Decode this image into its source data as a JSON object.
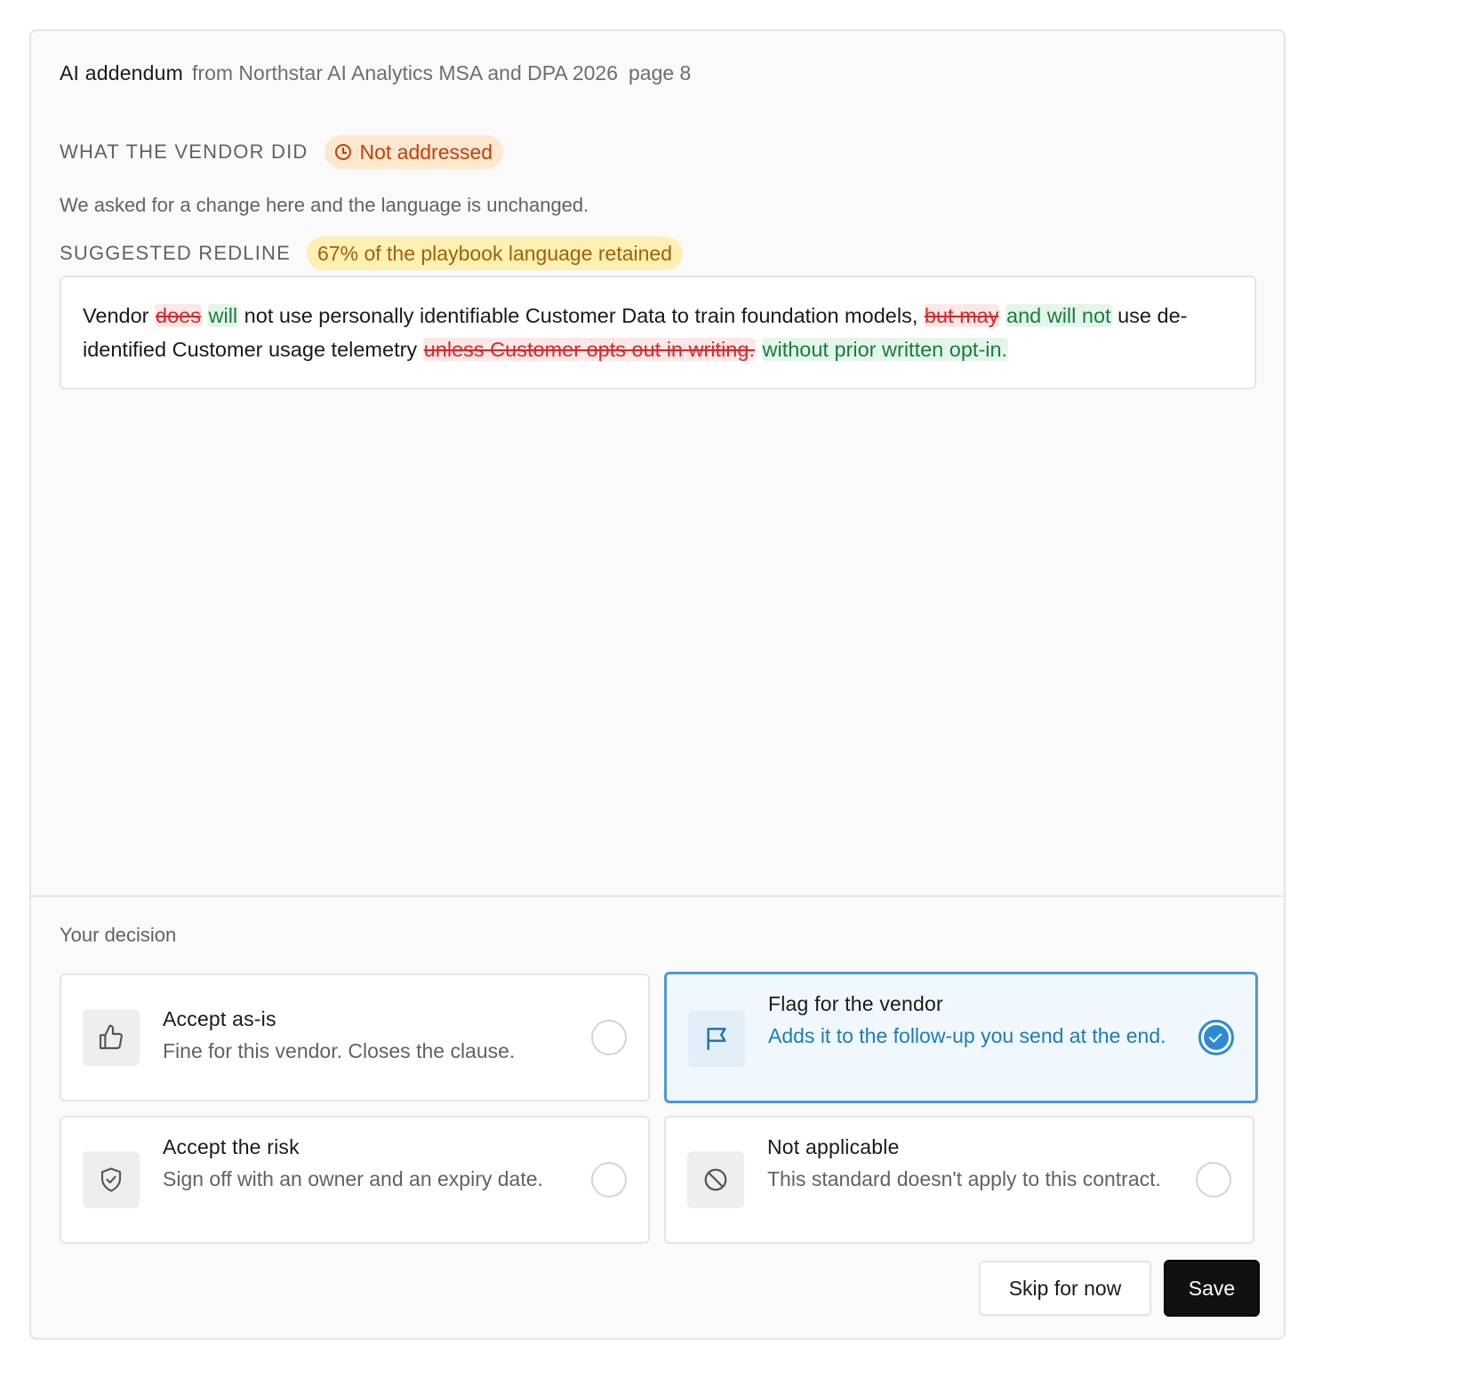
{
  "clause": {
    "name": "AI addendum",
    "source": "from Northstar AI Analytics MSA and DPA 2026",
    "page": "page 8"
  },
  "vendor_section": {
    "label": "WHAT THE VENDOR DID",
    "status": "Not addressed",
    "status_icon": "clock-icon",
    "description": "We asked for a change here and the language is unchanged."
  },
  "redline_section": {
    "label": "SUGGESTED REDLINE",
    "retention_badge": "67% of the playbook language retained",
    "segments": {
      "s1": "Vendor ",
      "d1": "does",
      "i1": "will",
      "s2": " not use personally identifiable Customer Data to train foundation models, ",
      "d2": "but may",
      "i2": "and will not",
      "s3": " use de-identified Customer usage telemetry ",
      "d3": "unless Customer opts out in writing.",
      "i3": "without prior written opt-in."
    }
  },
  "decision": {
    "label": "Your decision",
    "options": [
      {
        "title": "Accept as-is",
        "subtitle": "Fine for this vendor. Closes the clause.",
        "icon": "thumbs-up-icon",
        "selected": false
      },
      {
        "title": "Flag for the vendor",
        "subtitle": "Adds it to the follow-up you send at the end.",
        "icon": "flag-icon",
        "selected": true
      },
      {
        "title": "Accept the risk",
        "subtitle": "Sign off with an owner and an expiry date.",
        "icon": "shield-check-icon",
        "selected": false
      },
      {
        "title": "Not applicable",
        "subtitle": "This standard doesn't apply to this contract.",
        "icon": "ban-icon",
        "selected": false
      }
    ]
  },
  "actions": {
    "skip_label": "Skip for now",
    "save_label": "Save"
  },
  "colors": {
    "status_orange": "#c2410c",
    "badge_yellow": "#a16207",
    "deletion_red": "#dc2626",
    "insertion_green": "#15803d",
    "selected_blue": "#2b8ad6"
  }
}
